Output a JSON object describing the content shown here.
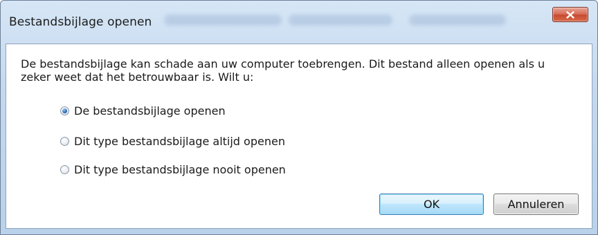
{
  "dialog": {
    "title": "Bestandsbijlage openen",
    "close_icon": "close-icon",
    "message": "De bestandsbijlage kan schade aan uw computer toebrengen. Dit bestand alleen openen als u zeker weet dat het betrouwbaar is. Wilt u:",
    "options": [
      {
        "label": "De bestandsbijlage openen",
        "selected": true
      },
      {
        "label": "Dit type bestandsbijlage altijd openen",
        "selected": false
      },
      {
        "label": "Dit type bestandsbijlage nooit openen",
        "selected": false
      }
    ],
    "buttons": {
      "ok_label": "OK",
      "cancel_label": "Annuleren"
    }
  },
  "colors": {
    "title_bar": "#c3d8ee",
    "close_button": "#c84a30",
    "ok_button_border": "#3c7fb1",
    "radio_selected": "#2f6fb8"
  }
}
